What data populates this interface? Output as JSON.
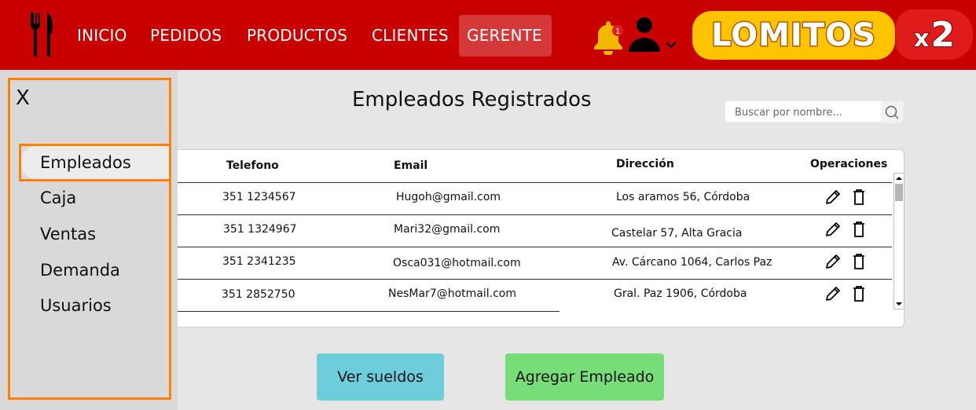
{
  "header": {
    "nav": [
      "INICIO",
      "PEDIDOS",
      "PRODUCTOS",
      "CLIENTES",
      "GERENTE"
    ],
    "active_nav": "GERENTE",
    "notification_count": "1",
    "brand": "LOMITOS",
    "brand_suffix_x": "x",
    "brand_suffix_num": "2",
    "icons": [
      "utensils-icon",
      "bell-icon",
      "user-icon",
      "chevron-down-icon"
    ]
  },
  "sidebar": {
    "close_label": "X",
    "items": [
      "Empleados",
      "Caja",
      "Ventas",
      "Demanda",
      "Usuarios"
    ],
    "active": "Empleados"
  },
  "main": {
    "title": "Empleados Registrados",
    "search_placeholder": "Buscar por nombre...",
    "columns": [
      "Telefono",
      "Email",
      "Dirección",
      "Operaciones"
    ],
    "rows": [
      {
        "telefono": "351 1234567",
        "email": "Hugoh@gmail.com",
        "direccion": "Los aramos 56, Córdoba"
      },
      {
        "telefono": "351 1324967",
        "email": "Mari32@gmail.com",
        "direccion": "Castelar 57, Alta Gracia"
      },
      {
        "telefono": "351 2341235",
        "email": "Osca031@hotmail.com",
        "direccion": "Av. Cárcano 1064, Carlos Paz"
      },
      {
        "telefono": "351 2852750",
        "email": "NesMar7@hotmail.com",
        "direccion": "Gral. Paz 1906, Córdoba"
      }
    ],
    "buttons": {
      "sueldos": "Ver sueldos",
      "agregar": "Agregar Empleado"
    }
  },
  "colors": {
    "header": "#c80000",
    "accent_outline": "#ff8000",
    "brand": "#ffc400",
    "btn_sueldos": "#6dcdda",
    "btn_agregar": "#76dd78"
  }
}
